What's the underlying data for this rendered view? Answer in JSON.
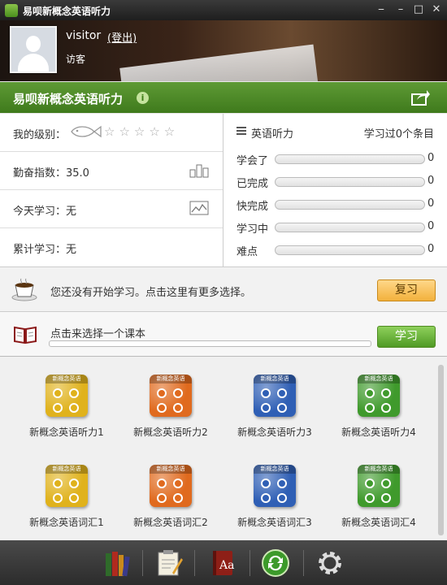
{
  "window": {
    "title": "易呗新概念英语听力"
  },
  "user": {
    "name": "visitor",
    "logout": "(登出)",
    "role": "访客"
  },
  "banner": {
    "title": "易呗新概念英语听力",
    "info_glyph": "i"
  },
  "stats": {
    "level_label": "我的级别：",
    "level_stars": "☆☆☆☆☆",
    "level_stars_filled": 0,
    "diligence_label": "勤奋指数：35.0",
    "today_label": "今天学习：无",
    "total_label": "累计学习：无"
  },
  "progress": {
    "title": "英语听力",
    "count": "学习过0个条目",
    "rows": [
      {
        "label": "学会了",
        "value": "0"
      },
      {
        "label": "已完成",
        "value": "0"
      },
      {
        "label": "快完成",
        "value": "0"
      },
      {
        "label": "学习中",
        "value": "0"
      },
      {
        "label": "难点",
        "value": "0"
      }
    ]
  },
  "review": {
    "text": "您还没有开始学习。点击这里有更多选择。",
    "button": "复习"
  },
  "course": {
    "text": "点击来选择一个课本",
    "button": "学习"
  },
  "books": [
    {
      "label": "新概念英语听力1",
      "cover": "新概念英语",
      "color": "#e0b21c"
    },
    {
      "label": "新概念英语听力2",
      "cover": "新概念英语",
      "color": "#e06a1e"
    },
    {
      "label": "新概念英语听力3",
      "cover": "新概念英语",
      "color": "#2f5fb5"
    },
    {
      "label": "新概念英语听力4",
      "cover": "新概念英语",
      "color": "#3f9a2c"
    },
    {
      "label": "新概念英语词汇1",
      "cover": "新概念英语",
      "color": "#e0b21c"
    },
    {
      "label": "新概念英语词汇2",
      "cover": "新概念英语",
      "color": "#e06a1e"
    },
    {
      "label": "新概念英语词汇3",
      "cover": "新概念英语",
      "color": "#2f5fb5"
    },
    {
      "label": "新概念英语词汇4",
      "cover": "新概念英语",
      "color": "#3f9a2c"
    }
  ],
  "toolbar": {
    "aa_glyph": "Aa"
  },
  "colors": {
    "accent_green": "#4f8a22",
    "review_orange": "#f2b13c",
    "titlebar": "#2a2a2a"
  },
  "icons": [
    "app-icon",
    "minimize-icon",
    "restore-icon",
    "close-icon",
    "avatar",
    "info-icon",
    "share-icon",
    "fish-icon",
    "stats-icon",
    "chart-icon",
    "menu-icon",
    "coffee-icon",
    "book-icon",
    "library-icon",
    "notes-icon",
    "dictionary-icon",
    "sync-icon",
    "settings-icon"
  ]
}
